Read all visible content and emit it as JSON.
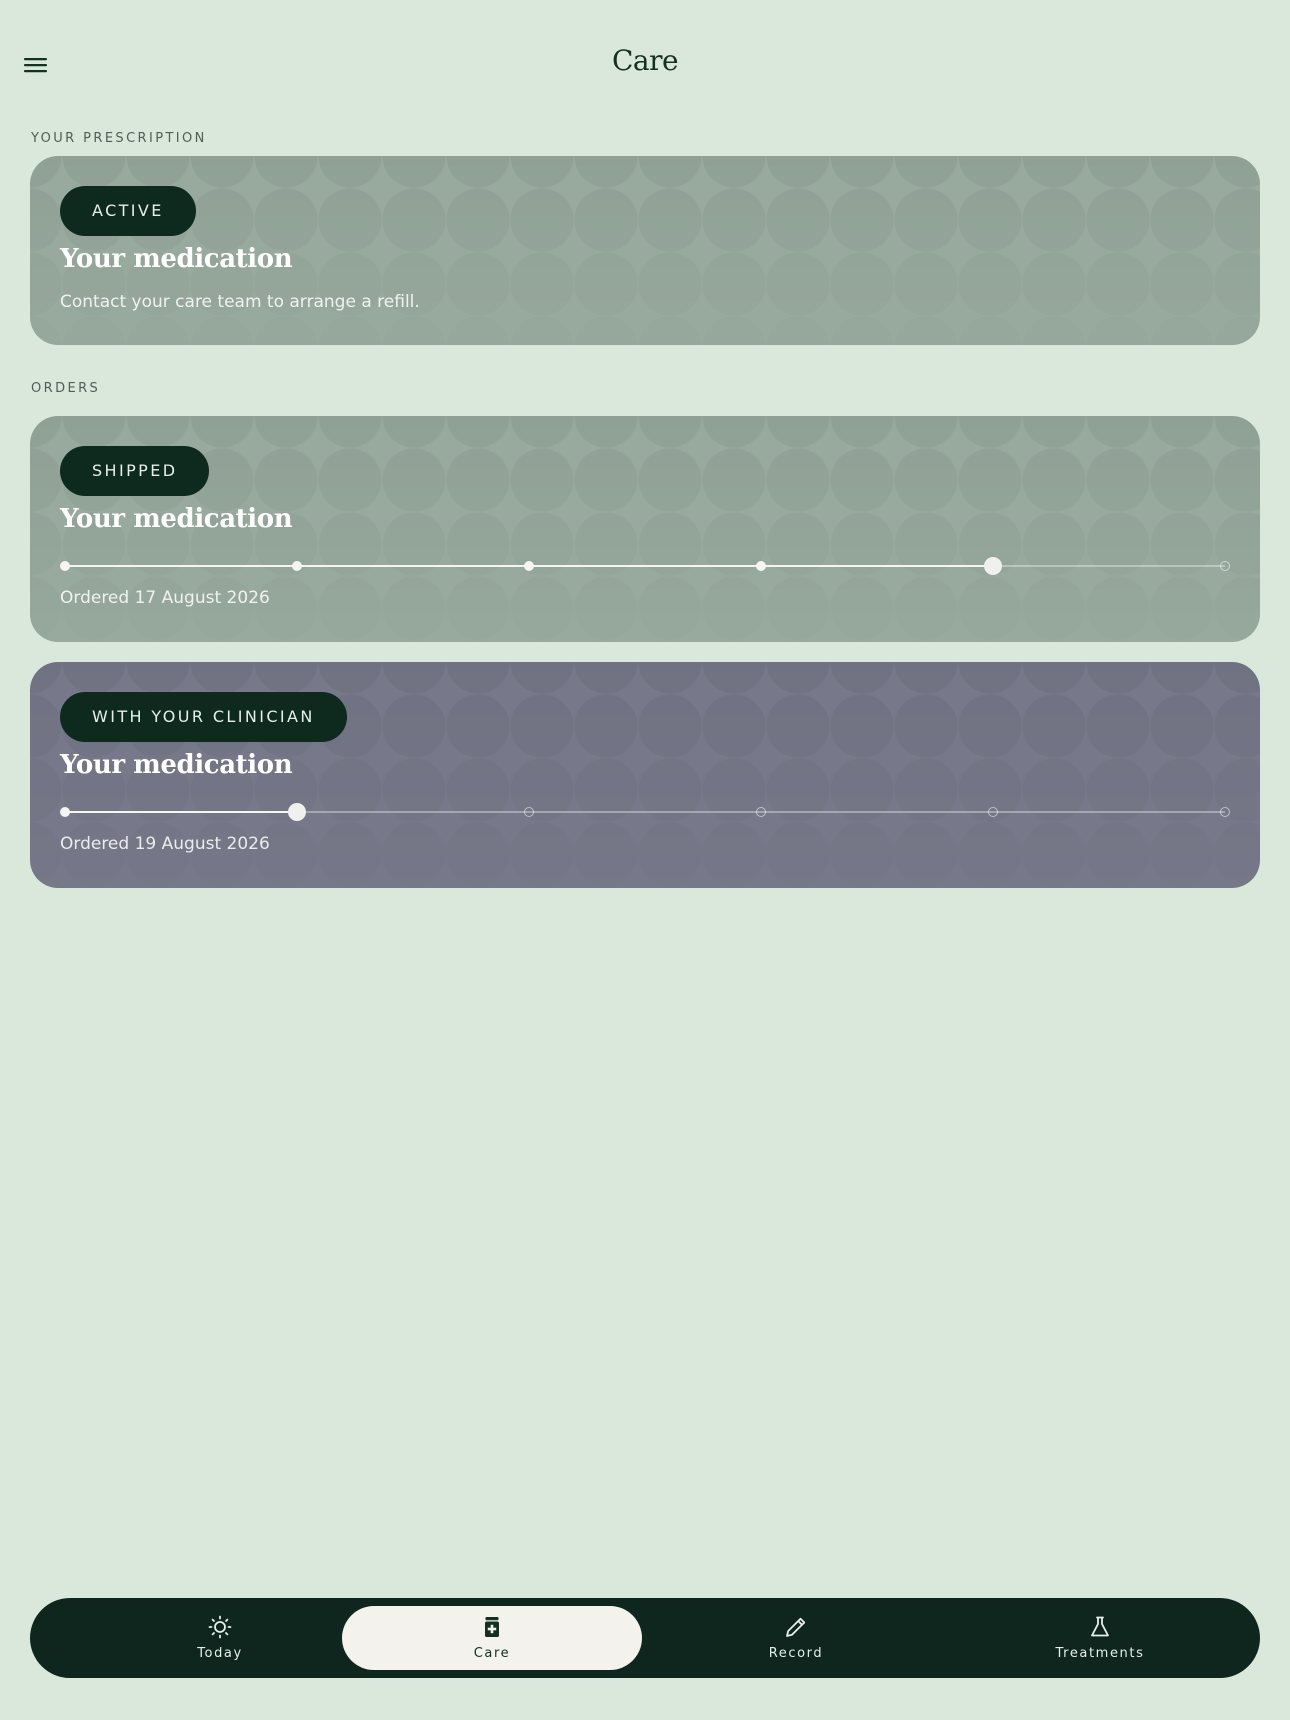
{
  "header": {
    "title": "Care",
    "menu_icon": "hamburger-menu-icon"
  },
  "prescription": {
    "section_label": "YOUR PRESCRIPTION",
    "card": {
      "status": "ACTIVE",
      "title": "Your medication",
      "note": "Contact your care team to arrange a refill.",
      "color": "#98a99e"
    }
  },
  "orders": {
    "section_label": "ORDERS",
    "items": [
      {
        "status": "SHIPPED",
        "title": "Your medication",
        "ordered": "Ordered 17 August 2026",
        "color": "#98a99e",
        "steps_total": 6,
        "current_step": 5
      },
      {
        "status": "WITH YOUR CLINICIAN",
        "title": "Your medication",
        "ordered": "Ordered 19 August 2026",
        "color": "#777889",
        "steps_total": 6,
        "current_step": 2
      }
    ]
  },
  "nav": {
    "items": [
      {
        "label": "Today",
        "icon": "sun-icon",
        "active": false
      },
      {
        "label": "Care",
        "icon": "medicine-bottle-icon",
        "active": true
      },
      {
        "label": "Record",
        "icon": "pencil-icon",
        "active": false
      },
      {
        "label": "Treatments",
        "icon": "flask-icon",
        "active": false
      }
    ]
  },
  "colors": {
    "background": "#dae8dc",
    "badge": "#0e2a1f",
    "nav_bar": "#0e261d",
    "nav_active": "#f3f2ed"
  }
}
